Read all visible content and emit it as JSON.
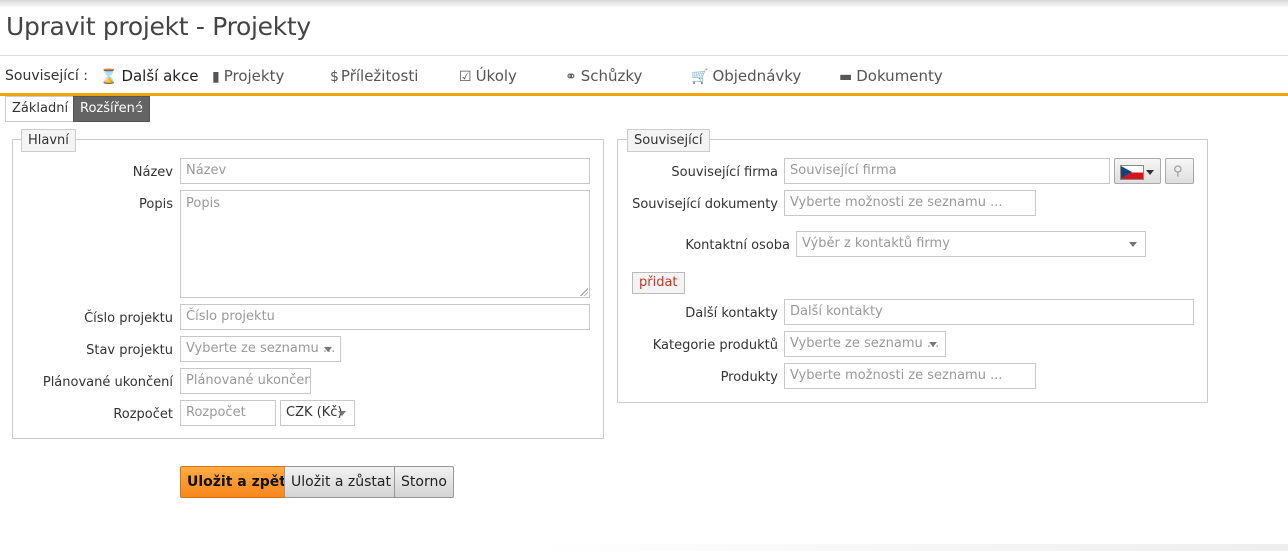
{
  "page": {
    "title": "Upravit projekt - Projekty"
  },
  "related": {
    "label": "Související :",
    "items": [
      {
        "label": "Další akce",
        "icon": "hourglass-icon"
      },
      {
        "label": "Projekty",
        "icon": "building-icon"
      },
      {
        "label": "Příležitosti",
        "icon": "dollar-icon"
      },
      {
        "label": "Úkoly",
        "icon": "calendar-check-icon"
      },
      {
        "label": "Schůzky",
        "icon": "handshake-icon"
      },
      {
        "label": "Objednávky",
        "icon": "cart-icon"
      },
      {
        "label": "Dokumenty",
        "icon": "folder-icon"
      }
    ]
  },
  "tabs": {
    "basic": "Základní",
    "extended": "Rozšířené"
  },
  "main": {
    "legend": "Hlavní",
    "name": {
      "label": "Název",
      "placeholder": "Název"
    },
    "description": {
      "label": "Popis",
      "placeholder": "Popis"
    },
    "project_number": {
      "label": "Číslo projektu",
      "placeholder": "Číslo projektu"
    },
    "status": {
      "label": "Stav projektu",
      "value": "Vyberte ze seznamu ..."
    },
    "planned_end": {
      "label": "Plánované ukončení",
      "placeholder": "Plánované ukončení"
    },
    "budget": {
      "label": "Rozpočet",
      "placeholder": "Rozpočet",
      "currency": "CZK (Kč)"
    }
  },
  "related_panel": {
    "legend": "Související",
    "company": {
      "label": "Související firma",
      "placeholder": "Související firma"
    },
    "documents": {
      "label": "Související dokumenty",
      "placeholder": "Vyberte možnosti ze seznamu ..."
    },
    "contact": {
      "label": "Kontaktní osoba",
      "value": "Výběr z kontaktů firmy"
    },
    "add_label": "přidat",
    "other_contacts": {
      "label": "Další kontakty",
      "placeholder": "Další kontakty"
    },
    "product_category": {
      "label": "Kategorie produktů",
      "value": "Vyberte ze seznamu ..."
    },
    "products": {
      "label": "Produkty",
      "placeholder": "Vyberte možnosti ze seznamu ..."
    }
  },
  "actions": {
    "save_back": "Uložit a zpět",
    "save_stay": "Uložit a zůstat",
    "cancel": "Storno"
  },
  "colors": {
    "accent": "#f0a30a",
    "primary_button": "#f7881c",
    "tab_selected": "#646464"
  }
}
